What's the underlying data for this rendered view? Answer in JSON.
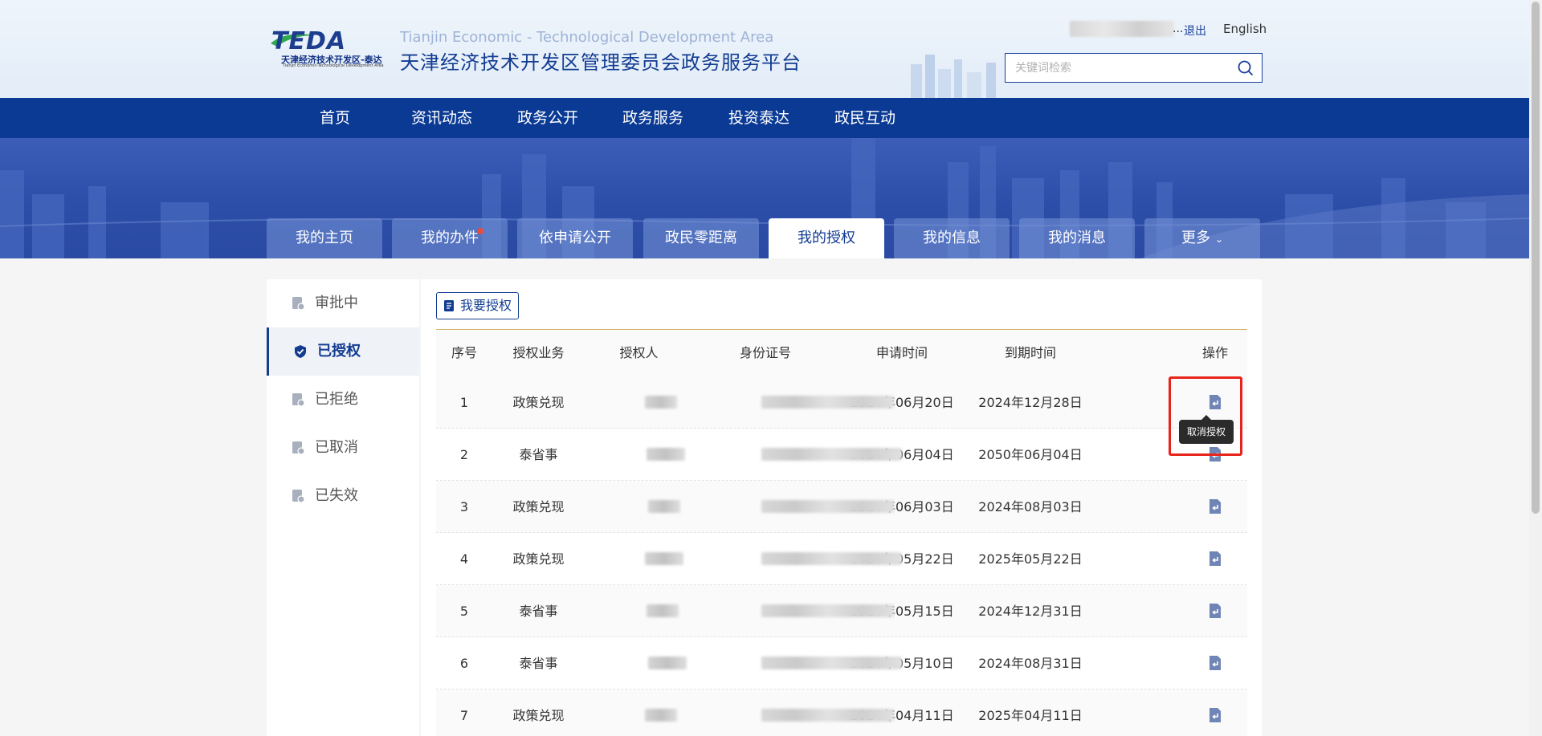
{
  "header": {
    "logo_text": "TEDA",
    "logo_subtitle": "天津经济技术开发区-泰达",
    "logo_tiny": "Tianjin Economic-Technological Development Area",
    "site_en": "Tianjin Economic - Technological Development Area",
    "site_cn": "天津经济技术开发区管理委员会政务服务平台",
    "user_ellipsis": "...",
    "logout": "退出",
    "language": "English",
    "search_placeholder": "关键词检索"
  },
  "nav": [
    "首页",
    "资讯动态",
    "政务公开",
    "政务服务",
    "投资泰达",
    "政民互动"
  ],
  "tabs": [
    {
      "label": "我的主页"
    },
    {
      "label": "我的办件"
    },
    {
      "label": "依申请公开"
    },
    {
      "label": "政民零距离"
    },
    {
      "label": "我的授权"
    },
    {
      "label": "我的信息"
    },
    {
      "label": "我的消息"
    },
    {
      "label": "更多"
    }
  ],
  "sidebar": [
    {
      "label": "审批中"
    },
    {
      "label": "已授权"
    },
    {
      "label": "已拒绝"
    },
    {
      "label": "已取消"
    },
    {
      "label": "已失效"
    }
  ],
  "main": {
    "auth_button": "我要授权",
    "columns": [
      "序号",
      "授权业务",
      "授权人",
      "身份证号",
      "申请时间",
      "到期时间",
      "操作"
    ],
    "rows": [
      {
        "no": "1",
        "business": "政策兑现",
        "apply": "2024年06月20日",
        "expire": "2024年12月28日"
      },
      {
        "no": "2",
        "business": "泰省事",
        "apply": "2024年06月04日",
        "expire": "2050年06月04日"
      },
      {
        "no": "3",
        "business": "政策兑现",
        "apply": "2024年06月03日",
        "expire": "2024年08月03日"
      },
      {
        "no": "4",
        "business": "政策兑现",
        "apply": "2024年05月22日",
        "expire": "2025年05月22日"
      },
      {
        "no": "5",
        "business": "泰省事",
        "apply": "2024年05月15日",
        "expire": "2024年12月31日"
      },
      {
        "no": "6",
        "business": "泰省事",
        "apply": "2024年05月10日",
        "expire": "2024年08月31日"
      },
      {
        "no": "7",
        "business": "政策兑现",
        "apply": "2024年04月11日",
        "expire": "2025年04月11日"
      }
    ],
    "tooltip": "取消授权"
  },
  "colors": {
    "primary": "#0a3a94",
    "accent_line": "#d7b56d",
    "highlight": "#e8231b",
    "badge_dot": "#e84c3d"
  },
  "icons": {
    "search": "search-icon",
    "cancel_auth": "cancel-auth-icon",
    "edit": "edit-doc-icon",
    "chevron": "chevron-down-icon"
  }
}
